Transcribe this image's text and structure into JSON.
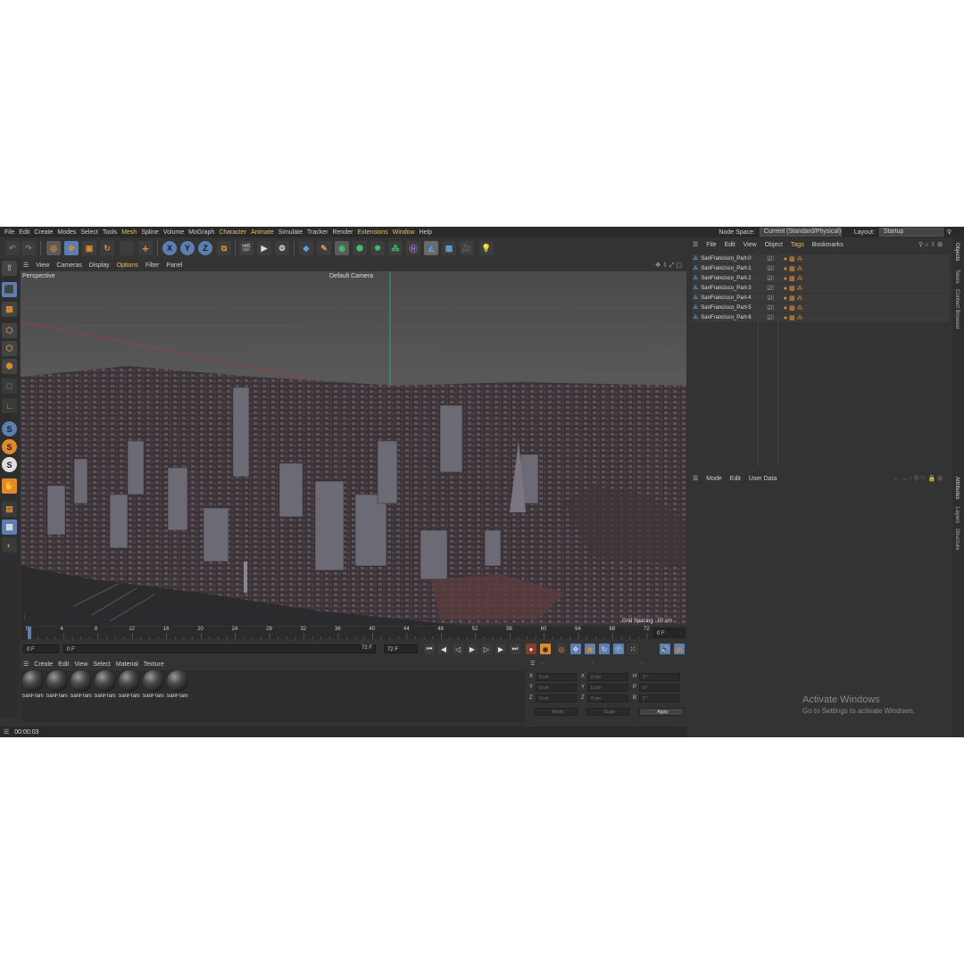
{
  "menubar": {
    "items": [
      "File",
      "Edit",
      "Create",
      "Modes",
      "Select",
      "Tools",
      "Mesh",
      "Spline",
      "Volume",
      "MoGraph",
      "Character",
      "Animate",
      "Simulate",
      "Tracker",
      "Render",
      "Extensions",
      "Window",
      "Help"
    ],
    "node_space_label": "Node Space:",
    "node_space_value": "Current (Standard/Physical)",
    "layout_label": "Layout:",
    "layout_value": "Startup"
  },
  "toolbar": {
    "axis_labels": [
      "X",
      "Y",
      "Z"
    ]
  },
  "palette": {
    "s_labels": [
      "S",
      "S",
      "S"
    ]
  },
  "viewport": {
    "menu": [
      "View",
      "Cameras",
      "Display",
      "Options",
      "Filter",
      "Panel"
    ],
    "label": "Perspective",
    "camera": "Default Camera",
    "grid_spacing": "Grid Spacing : 50 cm"
  },
  "timeline": {
    "ticks": [
      "0",
      "4",
      "8",
      "12",
      "16",
      "20",
      "24",
      "28",
      "32",
      "36",
      "40",
      "44",
      "48",
      "52",
      "56",
      "60",
      "64",
      "68",
      "72"
    ],
    "current_frame": "0 F",
    "start_field": "0 F",
    "min_field": "0 F",
    "end_field": "72 F",
    "max_field": "72 F"
  },
  "materials": {
    "menu": [
      "Create",
      "Edit",
      "View",
      "Select",
      "Material",
      "Texture"
    ],
    "items": [
      "SanFrani",
      "SanFrani",
      "SanFrani",
      "SanFrani",
      "SanFrani",
      "SanFrani",
      "SanFrani"
    ]
  },
  "coordinates": {
    "col_headers": [
      "--",
      "--",
      "--"
    ],
    "rows": [
      {
        "a": "X",
        "av": "0 cm",
        "b": "X",
        "bv": "0 cm",
        "c": "H",
        "cv": "0 °"
      },
      {
        "a": "Y",
        "av": "0 cm",
        "b": "Y",
        "bv": "0 cm",
        "c": "P",
        "cv": "0 °"
      },
      {
        "a": "Z",
        "av": "0 cm",
        "b": "Z",
        "bv": "0 cm",
        "c": "B",
        "cv": "0 °"
      }
    ],
    "space": "World",
    "mode": "Scale",
    "apply": "Apply"
  },
  "objects": {
    "menu": [
      "File",
      "Edit",
      "View",
      "Object",
      "Tags",
      "Bookmarks"
    ],
    "items": [
      "SanFrancisco_Part-0",
      "SanFrancisco_Part-1",
      "SanFrancisco_Part-2",
      "SanFrancisco_Part-3",
      "SanFrancisco_Part-4",
      "SanFrancisco_Part-5",
      "SanFrancisco_Part-6"
    ]
  },
  "attributes": {
    "menu": [
      "Mode",
      "Edit",
      "User Data"
    ]
  },
  "side_tabs": {
    "top": [
      "Objects",
      "Takes",
      "Content Browser"
    ],
    "bottom": [
      "Attributes",
      "Layers",
      "Structure"
    ]
  },
  "status": {
    "time": "00:00:03"
  },
  "watermark": {
    "title": "Activate Windows",
    "subtitle": "Go to Settings to activate Windows."
  },
  "colors": {
    "accent": "#e6c266",
    "active_button": "#5a7fb0",
    "orange": "#e08a2a"
  }
}
